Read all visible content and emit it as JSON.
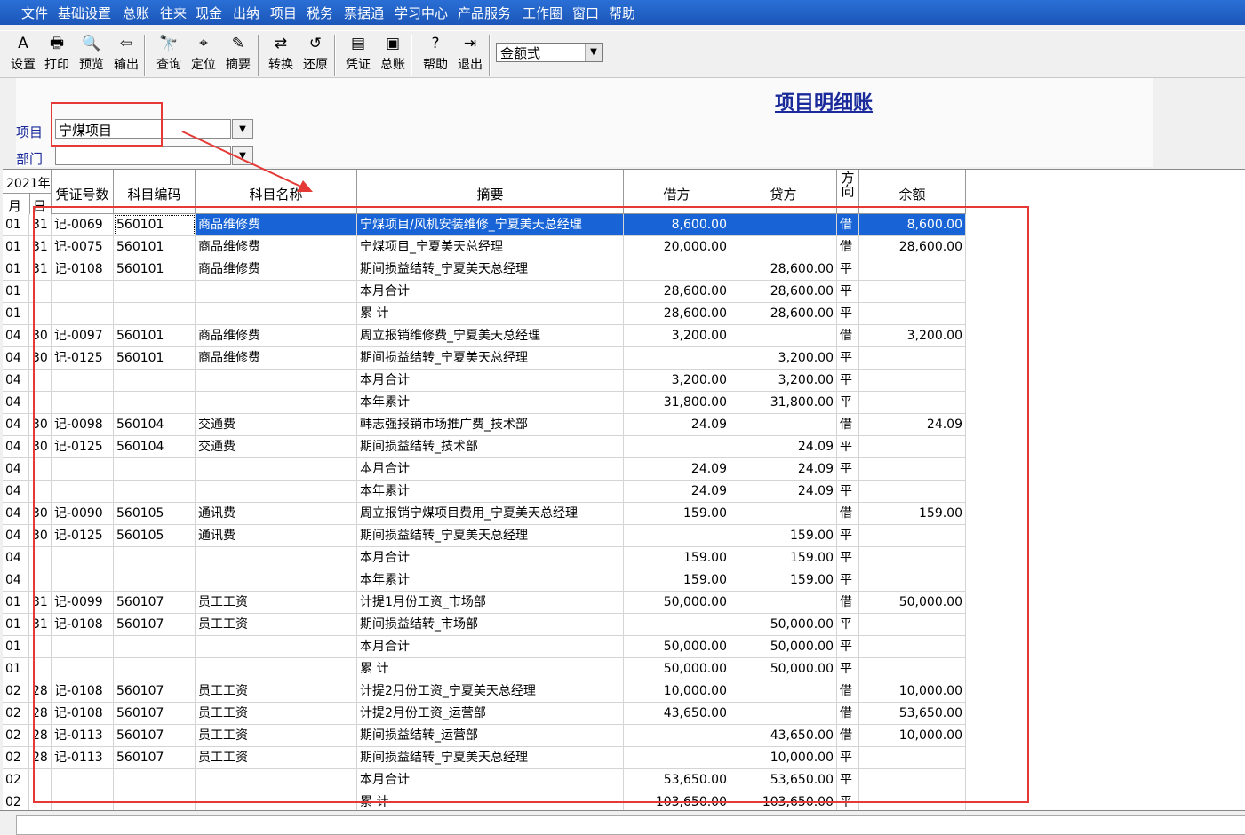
{
  "menu": [
    "文件",
    "基础设置",
    "总账",
    "往来",
    "现金",
    "出纳",
    "项目",
    "税务",
    "票据通",
    "学习中心",
    "产品服务",
    "工作圈",
    "窗口",
    "帮助"
  ],
  "toolbar": [
    {
      "label": "设置",
      "icon": "A"
    },
    {
      "label": "打印",
      "icon": "🖶"
    },
    {
      "label": "预览",
      "icon": "🔍"
    },
    {
      "label": "输出",
      "icon": "⇦"
    },
    {
      "label": "查询",
      "icon": "🔭"
    },
    {
      "label": "定位",
      "icon": "⌖"
    },
    {
      "label": "摘要",
      "icon": "✎"
    },
    {
      "label": "转换",
      "icon": "⇄"
    },
    {
      "label": "还原",
      "icon": "↺"
    },
    {
      "label": "凭证",
      "icon": "▤"
    },
    {
      "label": "总账",
      "icon": "▣"
    },
    {
      "label": "帮助",
      "icon": "?"
    },
    {
      "label": "退出",
      "icon": "⇥"
    }
  ],
  "mode_select": "金额式",
  "report_title": "项目明细账",
  "filters": {
    "project_label": "项目",
    "project_value": "宁煤项目",
    "dept_label": "部门",
    "dept_value": ""
  },
  "table": {
    "headers": {
      "year": "2021年",
      "month": "月",
      "day": "日",
      "voucher": "凭证号数",
      "code": "科目编码",
      "name": "科目名称",
      "summary": "摘要",
      "debit": "借方",
      "credit": "贷方",
      "dir": "方向",
      "balance": "余额"
    },
    "rows": [
      [
        "01",
        "31",
        "记-0069",
        "560101",
        "商品维修费",
        "宁煤项目/风机安装维修_宁夏美天总经理",
        "8,600.00",
        "",
        "借",
        "8,600.00"
      ],
      [
        "01",
        "31",
        "记-0075",
        "560101",
        "商品维修费",
        "宁煤项目_宁夏美天总经理",
        "20,000.00",
        "",
        "借",
        "28,600.00"
      ],
      [
        "01",
        "31",
        "记-0108",
        "560101",
        "商品维修费",
        "期间损益结转_宁夏美天总经理",
        "",
        "28,600.00",
        "平",
        ""
      ],
      [
        "01",
        "",
        "",
        "",
        "",
        "本月合计",
        "28,600.00",
        "28,600.00",
        "平",
        ""
      ],
      [
        "01",
        "",
        "",
        "",
        "",
        "累    计",
        "28,600.00",
        "28,600.00",
        "平",
        ""
      ],
      [
        "04",
        "30",
        "记-0097",
        "560101",
        "商品维修费",
        "周立报销维修费_宁夏美天总经理",
        "3,200.00",
        "",
        "借",
        "3,200.00"
      ],
      [
        "04",
        "30",
        "记-0125",
        "560101",
        "商品维修费",
        "期间损益结转_宁夏美天总经理",
        "",
        "3,200.00",
        "平",
        ""
      ],
      [
        "04",
        "",
        "",
        "",
        "",
        "本月合计",
        "3,200.00",
        "3,200.00",
        "平",
        ""
      ],
      [
        "04",
        "",
        "",
        "",
        "",
        "本年累计",
        "31,800.00",
        "31,800.00",
        "平",
        ""
      ],
      [
        "04",
        "30",
        "记-0098",
        "560104",
        "交通费",
        "韩志强报销市场推广费_技术部",
        "24.09",
        "",
        "借",
        "24.09"
      ],
      [
        "04",
        "30",
        "记-0125",
        "560104",
        "交通费",
        "期间损益结转_技术部",
        "",
        "24.09",
        "平",
        ""
      ],
      [
        "04",
        "",
        "",
        "",
        "",
        "本月合计",
        "24.09",
        "24.09",
        "平",
        ""
      ],
      [
        "04",
        "",
        "",
        "",
        "",
        "本年累计",
        "24.09",
        "24.09",
        "平",
        ""
      ],
      [
        "04",
        "30",
        "记-0090",
        "560105",
        "通讯费",
        "周立报销宁煤项目费用_宁夏美天总经理",
        "159.00",
        "",
        "借",
        "159.00"
      ],
      [
        "04",
        "30",
        "记-0125",
        "560105",
        "通讯费",
        "期间损益结转_宁夏美天总经理",
        "",
        "159.00",
        "平",
        ""
      ],
      [
        "04",
        "",
        "",
        "",
        "",
        "本月合计",
        "159.00",
        "159.00",
        "平",
        ""
      ],
      [
        "04",
        "",
        "",
        "",
        "",
        "本年累计",
        "159.00",
        "159.00",
        "平",
        ""
      ],
      [
        "01",
        "31",
        "记-0099",
        "560107",
        "员工工资",
        "计提1月份工资_市场部",
        "50,000.00",
        "",
        "借",
        "50,000.00"
      ],
      [
        "01",
        "31",
        "记-0108",
        "560107",
        "员工工资",
        "期间损益结转_市场部",
        "",
        "50,000.00",
        "平",
        ""
      ],
      [
        "01",
        "",
        "",
        "",
        "",
        "本月合计",
        "50,000.00",
        "50,000.00",
        "平",
        ""
      ],
      [
        "01",
        "",
        "",
        "",
        "",
        "累    计",
        "50,000.00",
        "50,000.00",
        "平",
        ""
      ],
      [
        "02",
        "28",
        "记-0108",
        "560107",
        "员工工资",
        "计提2月份工资_宁夏美天总经理",
        "10,000.00",
        "",
        "借",
        "10,000.00"
      ],
      [
        "02",
        "28",
        "记-0108",
        "560107",
        "员工工资",
        "计提2月份工资_运营部",
        "43,650.00",
        "",
        "借",
        "53,650.00"
      ],
      [
        "02",
        "28",
        "记-0113",
        "560107",
        "员工工资",
        "期间损益结转_运营部",
        "",
        "43,650.00",
        "借",
        "10,000.00"
      ],
      [
        "02",
        "28",
        "记-0113",
        "560107",
        "员工工资",
        "期间损益结转_宁夏美天总经理",
        "",
        "10,000.00",
        "平",
        ""
      ],
      [
        "02",
        "",
        "",
        "",
        "",
        "本月合计",
        "53,650.00",
        "53,650.00",
        "平",
        ""
      ],
      [
        "02",
        "",
        "",
        "",
        "",
        "累    计",
        "103,650.00",
        "103,650.00",
        "平",
        ""
      ]
    ]
  },
  "colors": {
    "menubar": "#1c56b8",
    "selected_row": "#1864d6",
    "title": "#1a2a9a",
    "annotation": "#e53935"
  }
}
